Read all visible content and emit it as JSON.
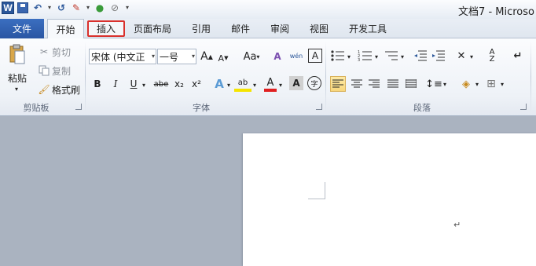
{
  "window": {
    "title": "文档7 - Microso"
  },
  "qat": {
    "word_icon_letter": "W",
    "undo_icon": "↶",
    "redo_icon": "↺",
    "paint_icon": "✎",
    "color_icon": "●",
    "eraser_icon": "⊘",
    "customize_icon": "▾"
  },
  "tabs": {
    "file": "文件",
    "home": "开始",
    "insert": "插入",
    "layout": "页面布局",
    "references": "引用",
    "mailings": "邮件",
    "review": "审阅",
    "view": "视图",
    "developer": "开发工具"
  },
  "clipboard": {
    "paste": "粘贴",
    "cut": "剪切",
    "copy": "复制",
    "format_painter": "格式刷",
    "group": "剪贴板"
  },
  "font": {
    "name": "宋体 (中文正 ",
    "size": "一号",
    "grow": "A",
    "shrink": "A",
    "change_case": "Aa",
    "clear": "A",
    "phonetic": "wén",
    "char_border": "A",
    "bold": "B",
    "italic": "I",
    "underline": "U",
    "strike": "abe",
    "subscript": "x₂",
    "superscript": "x²",
    "text_effect": "A",
    "highlight": "ab",
    "font_color": "A",
    "char_shading": "A",
    "enclose": "字",
    "group": "字体"
  },
  "paragraph": {
    "group": "段落"
  },
  "document": {
    "para_mark": "↵"
  },
  "colors": {
    "accent": "#2b579a",
    "highlight_border": "#d9302c"
  }
}
